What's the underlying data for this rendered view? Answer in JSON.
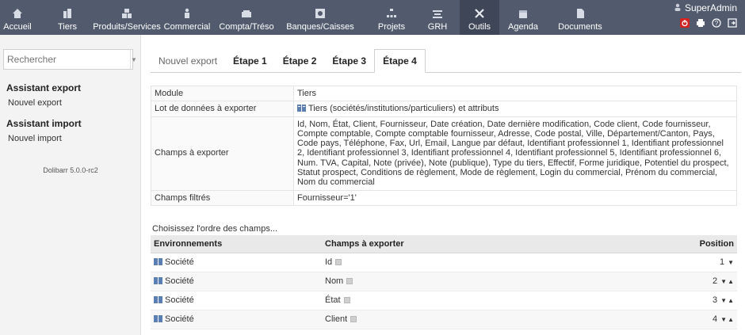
{
  "topnav": {
    "items": [
      {
        "label": "Accueil",
        "icon": "home-icon"
      },
      {
        "label": "Tiers",
        "icon": "building-icon"
      },
      {
        "label": "Produits/Services",
        "icon": "cubes-icon"
      },
      {
        "label": "Commercial",
        "icon": "briefcase-icon"
      },
      {
        "label": "Compta/Tréso",
        "icon": "money-icon"
      },
      {
        "label": "Banques/Caisses",
        "icon": "bank-icon"
      },
      {
        "label": "Projets",
        "icon": "sitemap-icon"
      },
      {
        "label": "GRH",
        "icon": "people-icon"
      },
      {
        "label": "Outils",
        "icon": "tools-icon"
      },
      {
        "label": "Agenda",
        "icon": "calendar-icon"
      },
      {
        "label": "Documents",
        "icon": "document-icon"
      }
    ],
    "active_index": 8,
    "user": "SuperAdmin",
    "colors": {
      "bar": "#525b6e",
      "active": "#3f4657",
      "logout": "#d22323"
    }
  },
  "sidebar": {
    "search_placeholder": "Rechercher",
    "export_title": "Assistant export",
    "export_link": "Nouvel export",
    "import_title": "Assistant import",
    "import_link": "Nouvel import",
    "version": "Dolibarr 5.0.0-rc2"
  },
  "tabs": [
    "Nouvel export",
    "Étape 1",
    "Étape 2",
    "Étape 3",
    "Étape 4"
  ],
  "info": {
    "module_label": "Module",
    "module_value": "Tiers",
    "lot_label": "Lot de données à exporter",
    "lot_value": "Tiers (sociétés/institutions/particuliers) et attributs",
    "fields_label": "Champs à exporter",
    "fields_value": "Id, Nom, État, Client, Fournisseur, Date création, Date dernière modification, Code client, Code fournisseur, Compte comptable, Compte comptable fournisseur, Adresse, Code postal, Ville, Département/Canton, Pays, Code pays, Téléphone, Fax, Url, Email, Langue par défaut, Identifiant professionnel 1, Identifiant professionnel 2, Identifiant professionnel 3, Identifiant professionnel 4, Identifiant professionnel 5, Identifiant professionnel 6, Num. TVA, Capital, Note (privée), Note (publique), Type du tiers, Effectif, Forme juridique, Potentiel du prospect, Statut prospect, Conditions de règlement, Mode de règlement, Login du commercial, Prénom du commercial, Nom du commercial",
    "filtered_label": "Champs filtrés",
    "filtered_value": "Fournisseur='1'"
  },
  "order": {
    "caption": "Choisissez l'ordre des champs...",
    "headers": [
      "Environnements",
      "Champs à exporter",
      "Position"
    ],
    "rows": [
      {
        "env": "Société",
        "field": "Id",
        "pos": "1"
      },
      {
        "env": "Société",
        "field": "Nom",
        "pos": "2"
      },
      {
        "env": "Société",
        "field": "État",
        "pos": "3"
      },
      {
        "env": "Société",
        "field": "Client",
        "pos": "4"
      }
    ]
  }
}
